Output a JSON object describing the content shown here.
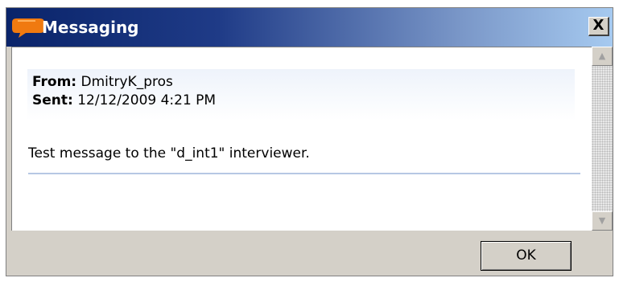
{
  "window": {
    "title": "Messaging",
    "title_icon": "chat-bubble-icon",
    "close_label": "X",
    "colors": {
      "title_gradient_start": "#0a246a",
      "title_gradient_end": "#a6caf0",
      "face": "#d4d0c8",
      "app_icon": "#f07a10"
    }
  },
  "message": {
    "from_label": "From:",
    "from_value": "DmitryK_pros",
    "sent_label": "Sent:",
    "sent_value": "12/12/2009 4:21 PM",
    "body": "Test message to the \"d_int1\" interviewer."
  },
  "scrollbar": {
    "up_icon": "arrow-up-icon",
    "down_icon": "arrow-down-icon",
    "up_glyph": "▲",
    "down_glyph": "▼"
  },
  "buttons": {
    "ok_label": "OK"
  }
}
